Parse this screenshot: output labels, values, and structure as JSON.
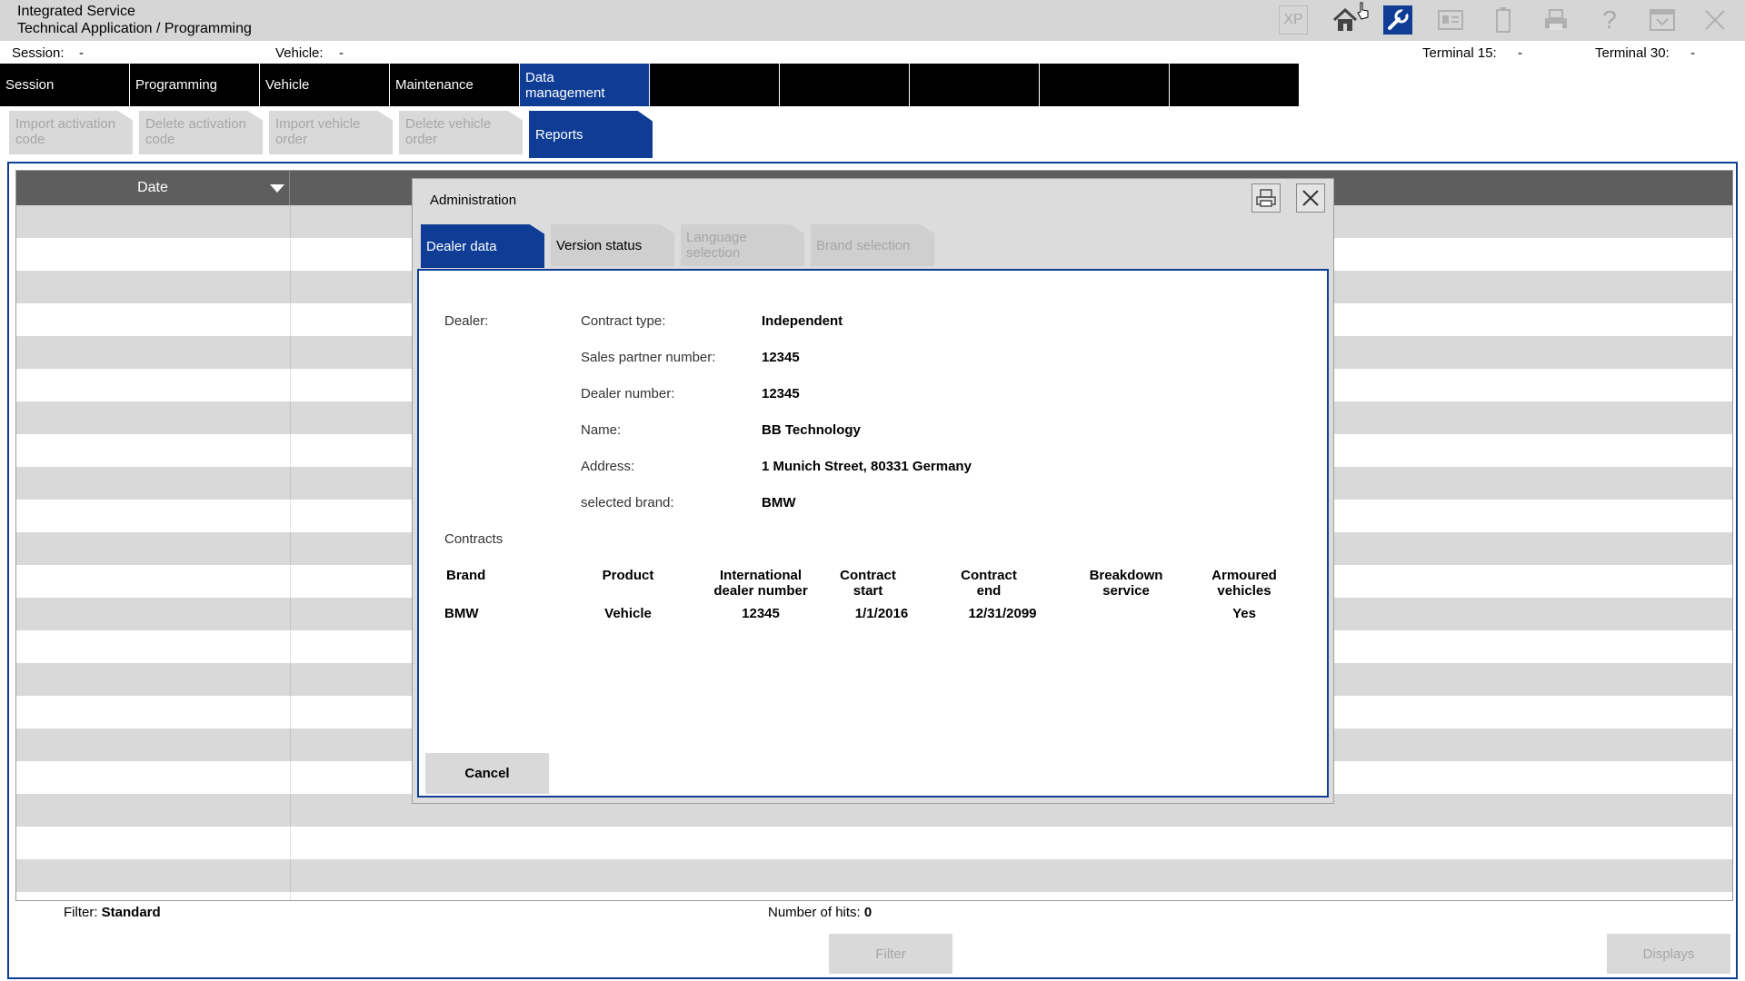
{
  "app": {
    "title_line1": "Integrated Service",
    "title_line2": "Technical Application / Programming",
    "toolbar": {
      "xp_label": "XP",
      "icons": [
        "home-icon",
        "wrench-icon",
        "id-card-icon",
        "battery-icon",
        "printer-icon",
        "help-icon",
        "dropdown-icon",
        "close-icon"
      ]
    }
  },
  "status": {
    "session_label": "Session:",
    "session_value": "-",
    "vehicle_label": "Vehicle:",
    "vehicle_value": "-",
    "terminal15_label": "Terminal 15:",
    "terminal15_value": "-",
    "terminal30_label": "Terminal 30:",
    "terminal30_value": "-"
  },
  "main_nav": {
    "items": [
      {
        "label": "Session"
      },
      {
        "label": "Programming"
      },
      {
        "label": "Vehicle"
      },
      {
        "label": "Maintenance"
      },
      {
        "label": "Data\nmanagement"
      },
      {
        "label": ""
      },
      {
        "label": ""
      },
      {
        "label": ""
      },
      {
        "label": ""
      },
      {
        "label": ""
      }
    ],
    "selected_index": 4
  },
  "sub_nav": {
    "items": [
      {
        "label": "Import activation code"
      },
      {
        "label": "Delete activation code"
      },
      {
        "label": "Import vehicle order"
      },
      {
        "label": "Delete vehicle order"
      },
      {
        "label": "Reports"
      }
    ],
    "selected_index": 4
  },
  "grid": {
    "date_header": "Date"
  },
  "footer": {
    "filter_label": "Filter:",
    "filter_value": "Standard",
    "hits_label": "Number of hits:",
    "hits_value": "0",
    "filter_button": "Filter",
    "displays_button": "Displays"
  },
  "modal": {
    "title": "Administration",
    "tabs": [
      {
        "label": "Dealer data"
      },
      {
        "label": "Version status"
      },
      {
        "label": "Language selection"
      },
      {
        "label": "Brand selection"
      }
    ],
    "dealer_label": "Dealer:",
    "fields": [
      {
        "label": "Contract type:",
        "value": "Independent"
      },
      {
        "label": "Sales partner number:",
        "value": "12345"
      },
      {
        "label": "Dealer number:",
        "value": "12345"
      },
      {
        "label": "Name:",
        "value": "BB Technology"
      },
      {
        "label": "Address:",
        "value": "1 Munich Street, 80331 Germany"
      },
      {
        "label": "selected brand:",
        "value": "BMW"
      }
    ],
    "contracts_label": "Contracts",
    "contracts_headers": [
      "Brand",
      "Product",
      "International dealer number",
      "Contract start",
      "Contract end",
      "Breakdown service",
      "Armoured vehicles"
    ],
    "contracts_rows": [
      [
        "BMW",
        "Vehicle",
        "12345",
        "1/1/2016",
        "12/31/2099",
        "",
        "Yes"
      ]
    ],
    "cancel_label": "Cancel"
  }
}
